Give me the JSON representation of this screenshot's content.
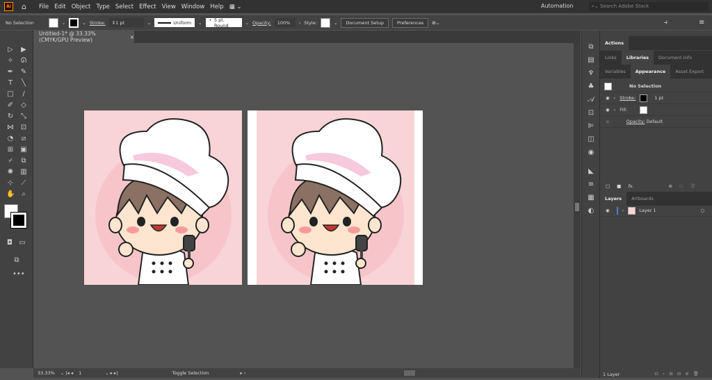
{
  "app": {
    "logo": "Ai",
    "menus": [
      "File",
      "Edit",
      "Object",
      "Type",
      "Select",
      "Effect",
      "View",
      "Window",
      "Help"
    ],
    "workspace": "Automation",
    "search_placeholder": "Search Adobe Stock"
  },
  "control": {
    "selection": "No Selection",
    "stroke_label": "Stroke:",
    "stroke_value": "1 pt",
    "profile": "Uniform",
    "brush": "5 pt. Round",
    "opacity_label": "Opacity:",
    "opacity_value": "100%",
    "style_label": "Style:",
    "document_setup": "Document Setup",
    "preferences": "Preferences"
  },
  "document": {
    "tab_title": "Untitled-1* @ 33.33% (CMYK/GPU Preview)",
    "close": "×"
  },
  "status": {
    "zoom": "33.33%",
    "artboard": "1",
    "toggle": "Toggle Selection"
  },
  "panels": {
    "top_tab": "Actions",
    "row2": [
      "Links",
      "Libraries",
      "Document Info"
    ],
    "row3": [
      "Variables",
      "Appearance",
      "Asset Export"
    ],
    "appearance": {
      "title": "No Selection",
      "stroke_label": "Stroke:",
      "stroke_value": "1 pt",
      "fill_label": "Fill:",
      "opacity_label": "Opacity:",
      "opacity_value": "Default",
      "fx": "fx."
    },
    "layers_tabs": [
      "Layers",
      "Artboards"
    ],
    "layer_name": "Layer 1",
    "layer_count": "1 Layer"
  },
  "colors": {
    "artboard": "#f9d4d6",
    "accent": "#4a7fd4"
  }
}
